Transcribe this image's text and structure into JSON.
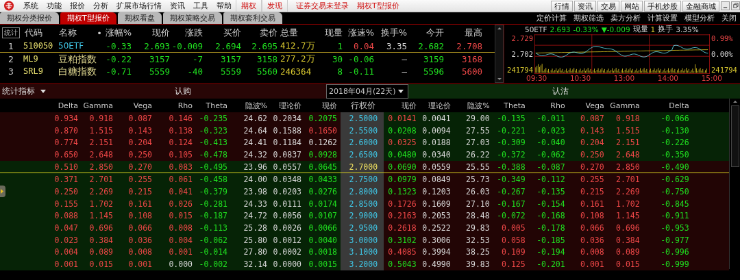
{
  "menu": [
    {
      "label": "系统",
      "kind": "plain"
    },
    {
      "label": "功能",
      "kind": "plain"
    },
    {
      "label": "报价",
      "kind": "plain"
    },
    {
      "label": "分析",
      "kind": "plain"
    },
    {
      "label": "扩展市场行情",
      "kind": "plain"
    },
    {
      "label": "资讯",
      "kind": "plain"
    },
    {
      "label": "工具",
      "kind": "plain"
    },
    {
      "label": "帮助",
      "kind": "plain"
    },
    {
      "label": "期权",
      "kind": "accent"
    },
    {
      "label": "发现",
      "kind": "accent"
    }
  ],
  "status": [
    "证券交易未登录",
    "期权T型报价"
  ],
  "top_buttons": [
    "行情",
    "资讯",
    "交易",
    "网站",
    "手机炒股",
    "金融商城"
  ],
  "tabs": [
    {
      "label": "期权分类报价",
      "selected": false
    },
    {
      "label": "期权T型报价",
      "selected": true
    },
    {
      "label": "期权看盘",
      "selected": false
    },
    {
      "label": "期权策略交易",
      "selected": false
    },
    {
      "label": "期权套利交易",
      "selected": false
    }
  ],
  "tools": [
    "定价计算",
    "期权筛选",
    "卖方分析",
    "计算设置",
    "模型分析",
    "关闭"
  ],
  "quote": {
    "stats_label": "统计",
    "columns": [
      "代码",
      "名称",
      "•",
      "涨幅%",
      "现价",
      "涨跌",
      "买价",
      "卖价",
      "总量",
      "现量",
      "涨速%",
      "换手%",
      "今开",
      "最高"
    ],
    "rows": [
      {
        "index": "1",
        "code": "510050",
        "name": "50ETF",
        "kind": "etf",
        "change_pct": "-0.33",
        "price": "2.693",
        "change": "-0.009",
        "bid": "2.694",
        "ask": "2.695",
        "volume": "412.7万",
        "last_volume": "1",
        "speed": "0.04",
        "turnover": "3.35",
        "open": "2.682",
        "high": "2.708"
      },
      {
        "index": "2",
        "code": "ML9",
        "name": "豆粕指数",
        "kind": "index",
        "change_pct": "-0.22",
        "price": "3157",
        "change": "-7",
        "bid": "3157",
        "ask": "3158",
        "volume": "277.2万",
        "last_volume": "30",
        "speed": "-0.06",
        "turnover": "–",
        "open": "3159",
        "high": "3168"
      },
      {
        "index": "3",
        "code": "SRL9",
        "name": "白糖指数",
        "kind": "index",
        "change_pct": "-0.71",
        "price": "5559",
        "change": "-40",
        "bid": "5559",
        "ask": "5560",
        "volume": "246364",
        "last_volume": "8",
        "speed": "-0.11",
        "turnover": "–",
        "open": "5596",
        "high": "5600"
      }
    ]
  },
  "mini_chart": {
    "header": [
      "50ETF",
      "2.693",
      "-0.33%",
      "▼-0.009",
      "现量",
      "1",
      "换手",
      "3.35%"
    ],
    "left_labels": [
      "2.729",
      "2.702",
      "241794"
    ],
    "right_labels": [
      "0.99%",
      "0.00%",
      "241794"
    ],
    "times": [
      "09:30",
      "10:30",
      "13:00",
      "14:00",
      "15:00"
    ]
  },
  "options": {
    "indicator_menu": "统计指标",
    "call_label": "认购",
    "expiry": "2018年04月(22天)",
    "put_label": "认沽",
    "call_columns": [
      "Delta",
      "Gamma",
      "Vega",
      "Rho",
      "Theta",
      "隐波%",
      "理论价",
      "现价"
    ],
    "strike_column": "行权价",
    "put_columns": [
      "现价",
      "理论价",
      "隐波%",
      "Theta",
      "Rho",
      "Vega",
      "Gamma",
      "Delta"
    ],
    "rows": [
      {
        "strike": "2.5000",
        "atm": false,
        "call_itm": true,
        "put_itm": false,
        "call": {
          "delta": "0.934",
          "gamma": "0.918",
          "vega": "0.087",
          "rho": "0.146",
          "theta": "-0.235",
          "iv": "24.62",
          "theo": "0.2034",
          "price": "0.2075",
          "up": false,
          "down": true
        },
        "put": {
          "price": "0.0141",
          "up": true,
          "down": false,
          "theo": "0.0041",
          "iv": "29.00",
          "theta": "-0.135",
          "rho": "-0.011",
          "vega": "0.087",
          "gamma": "0.918",
          "delta": "-0.066"
        }
      },
      {
        "strike": "2.5500",
        "atm": false,
        "call_itm": true,
        "put_itm": false,
        "call": {
          "delta": "0.870",
          "gamma": "1.515",
          "vega": "0.143",
          "rho": "0.138",
          "theta": "-0.323",
          "iv": "24.64",
          "theo": "0.1588",
          "price": "0.1650",
          "up": true,
          "down": false
        },
        "put": {
          "price": "0.0208",
          "up": false,
          "down": true,
          "theo": "0.0094",
          "iv": "27.55",
          "theta": "-0.221",
          "rho": "-0.023",
          "vega": "0.143",
          "gamma": "1.515",
          "delta": "-0.130"
        }
      },
      {
        "strike": "2.6000",
        "atm": false,
        "call_itm": true,
        "put_itm": false,
        "call": {
          "delta": "0.774",
          "gamma": "2.151",
          "vega": "0.204",
          "rho": "0.124",
          "theta": "-0.413",
          "iv": "24.41",
          "theo": "0.1184",
          "price": "0.1262",
          "up": false,
          "down": false
        },
        "put": {
          "price": "0.0325",
          "up": true,
          "down": false,
          "theo": "0.0188",
          "iv": "27.03",
          "theta": "-0.309",
          "rho": "-0.040",
          "vega": "0.204",
          "gamma": "2.151",
          "delta": "-0.226"
        }
      },
      {
        "strike": "2.6500",
        "atm": false,
        "call_itm": true,
        "put_itm": false,
        "call": {
          "delta": "0.650",
          "gamma": "2.648",
          "vega": "0.250",
          "rho": "0.105",
          "theta": "-0.478",
          "iv": "24.32",
          "theo": "0.0837",
          "price": "0.0928",
          "up": false,
          "down": true
        },
        "put": {
          "price": "0.0480",
          "up": false,
          "down": true,
          "theo": "0.0340",
          "iv": "26.22",
          "theta": "-0.372",
          "rho": "-0.062",
          "vega": "0.250",
          "gamma": "2.648",
          "delta": "-0.350"
        }
      },
      {
        "strike": "2.7000",
        "atm": true,
        "call_itm": false,
        "put_itm": true,
        "call": {
          "delta": "0.510",
          "gamma": "2.850",
          "vega": "0.270",
          "rho": "0.083",
          "theta": "-0.495",
          "iv": "23.96",
          "theo": "0.0557",
          "price": "0.0645",
          "up": false,
          "down": true
        },
        "put": {
          "price": "0.0690",
          "up": false,
          "down": true,
          "theo": "0.0559",
          "iv": "25.55",
          "theta": "-0.388",
          "rho": "-0.087",
          "vega": "0.270",
          "gamma": "2.850",
          "delta": "-0.490"
        }
      },
      {
        "strike": "2.7500",
        "atm": false,
        "call_itm": false,
        "put_itm": true,
        "call": {
          "delta": "0.371",
          "gamma": "2.701",
          "vega": "0.255",
          "rho": "0.061",
          "theta": "-0.458",
          "iv": "24.00",
          "theo": "0.0348",
          "price": "0.0433",
          "up": false,
          "down": true
        },
        "put": {
          "price": "0.0979",
          "up": false,
          "down": true,
          "theo": "0.0849",
          "iv": "25.73",
          "theta": "-0.349",
          "rho": "-0.112",
          "vega": "0.255",
          "gamma": "2.701",
          "delta": "-0.629"
        }
      },
      {
        "strike": "2.8000",
        "atm": false,
        "call_itm": false,
        "put_itm": true,
        "call": {
          "delta": "0.250",
          "gamma": "2.269",
          "vega": "0.215",
          "rho": "0.041",
          "theta": "-0.379",
          "iv": "23.98",
          "theo": "0.0203",
          "price": "0.0276",
          "up": false,
          "down": true
        },
        "put": {
          "price": "0.1323",
          "up": false,
          "down": true,
          "theo": "0.1203",
          "iv": "26.03",
          "theta": "-0.267",
          "rho": "-0.135",
          "vega": "0.215",
          "gamma": "2.269",
          "delta": "-0.750"
        }
      },
      {
        "strike": "2.8500",
        "atm": false,
        "call_itm": false,
        "put_itm": true,
        "call": {
          "delta": "0.155",
          "gamma": "1.702",
          "vega": "0.161",
          "rho": "0.026",
          "theta": "-0.281",
          "iv": "24.33",
          "theo": "0.0111",
          "price": "0.0174",
          "up": false,
          "down": true
        },
        "put": {
          "price": "0.1726",
          "up": true,
          "down": false,
          "theo": "0.1609",
          "iv": "27.10",
          "theta": "-0.167",
          "rho": "-0.154",
          "vega": "0.161",
          "gamma": "1.702",
          "delta": "-0.845"
        }
      },
      {
        "strike": "2.9000",
        "atm": false,
        "call_itm": false,
        "put_itm": true,
        "call": {
          "delta": "0.088",
          "gamma": "1.145",
          "vega": "0.108",
          "rho": "0.015",
          "theta": "-0.187",
          "iv": "24.72",
          "theo": "0.0056",
          "price": "0.0107",
          "up": false,
          "down": true
        },
        "put": {
          "price": "0.2163",
          "up": true,
          "down": false,
          "theo": "0.2053",
          "iv": "28.48",
          "theta": "-0.072",
          "rho": "-0.168",
          "vega": "0.108",
          "gamma": "1.145",
          "delta": "-0.911"
        }
      },
      {
        "strike": "2.9500",
        "atm": false,
        "call_itm": false,
        "put_itm": true,
        "call": {
          "delta": "0.047",
          "gamma": "0.696",
          "vega": "0.066",
          "rho": "0.008",
          "theta": "-0.113",
          "iv": "25.28",
          "theo": "0.0026",
          "price": "0.0066",
          "up": false,
          "down": true
        },
        "put": {
          "price": "0.2618",
          "up": true,
          "down": false,
          "theo": "0.2522",
          "iv": "29.83",
          "theta": "0.005",
          "rho": "-0.178",
          "vega": "0.066",
          "gamma": "0.696",
          "delta": "-0.953"
        }
      },
      {
        "strike": "3.0000",
        "atm": false,
        "call_itm": false,
        "put_itm": true,
        "call": {
          "delta": "0.023",
          "gamma": "0.384",
          "vega": "0.036",
          "rho": "0.004",
          "theta": "-0.062",
          "iv": "25.80",
          "theo": "0.0012",
          "price": "0.0040",
          "up": false,
          "down": true
        },
        "put": {
          "price": "0.3102",
          "up": false,
          "down": true,
          "theo": "0.3006",
          "iv": "32.53",
          "theta": "0.058",
          "rho": "-0.185",
          "vega": "0.036",
          "gamma": "0.384",
          "delta": "-0.977"
        }
      },
      {
        "strike": "3.1000",
        "atm": false,
        "call_itm": false,
        "put_itm": true,
        "call": {
          "delta": "0.004",
          "gamma": "0.089",
          "vega": "0.008",
          "rho": "0.001",
          "theta": "-0.014",
          "iv": "27.80",
          "theo": "0.0002",
          "price": "0.0018",
          "up": false,
          "down": true
        },
        "put": {
          "price": "0.4085",
          "up": true,
          "down": false,
          "theo": "0.3994",
          "iv": "38.25",
          "theta": "0.109",
          "rho": "-0.194",
          "vega": "0.008",
          "gamma": "0.089",
          "delta": "-0.996"
        }
      },
      {
        "strike": "3.2000",
        "atm": false,
        "call_itm": false,
        "put_itm": true,
        "call": {
          "delta": "0.001",
          "gamma": "0.015",
          "vega": "0.001",
          "rho": "0.000",
          "theta": "-0.002",
          "iv": "32.14",
          "theo": "0.0000",
          "price": "0.0015",
          "up": false,
          "down": true
        },
        "put": {
          "price": "0.5043",
          "up": false,
          "down": true,
          "theo": "0.4990",
          "iv": "39.83",
          "theta": "0.125",
          "rho": "-0.201",
          "vega": "0.001",
          "gamma": "0.015",
          "delta": "-0.999"
        }
      }
    ]
  }
}
